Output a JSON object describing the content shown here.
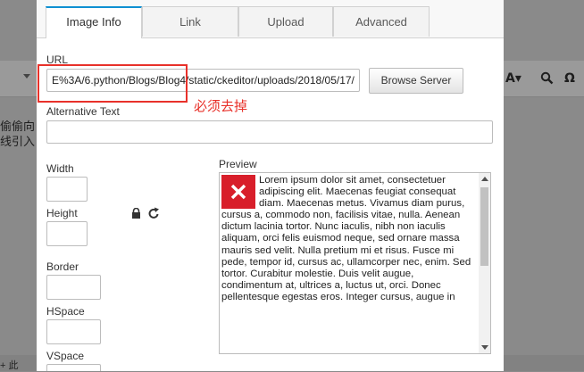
{
  "background_editor": {
    "content_line_1": "偷偷向",
    "content_line_2": "线引入",
    "bottom_text": "+ 此"
  },
  "dialog": {
    "tabs": [
      {
        "label": "Image Info"
      },
      {
        "label": "Link"
      },
      {
        "label": "Upload"
      },
      {
        "label": "Advanced"
      }
    ],
    "url_label": "URL",
    "url_value": "E%3A/6.python/Blogs/Blog4/static/ckeditor/uploads/2018/05/17/",
    "browse_server_label": "Browse Server",
    "annotation": "必须去掉",
    "alt_text_label": "Alternative Text",
    "alt_text_value": "",
    "width_label": "Width",
    "height_label": "Height",
    "border_label": "Border",
    "hspace_label": "HSpace",
    "vspace_label": "VSpace",
    "preview_label": "Preview",
    "preview_text": "Lorem ipsum dolor sit amet, consectetuer adipiscing elit. Maecenas feugiat consequat diam. Maecenas metus. Vivamus diam purus, cursus a, commodo non, facilisis vitae, nulla. Aenean dictum lacinia tortor. Nunc iaculis, nibh non iaculis aliquam, orci felis euismod neque, sed ornare massa mauris sed velit. Nulla pretium mi et risus. Fusce mi pede, tempor id, cursus ac, ullamcorper nec, enim. Sed tortor. Curabitur molestie. Duis velit augue, condimentum at, ultrices a, luctus ut, orci. Donec pellentesque egestas eros. Integer cursus, augue in"
  },
  "colors": {
    "active_tab_accent": "#0e90d2",
    "annotation": "#e8312a",
    "broken_image": "#d81e2a"
  }
}
